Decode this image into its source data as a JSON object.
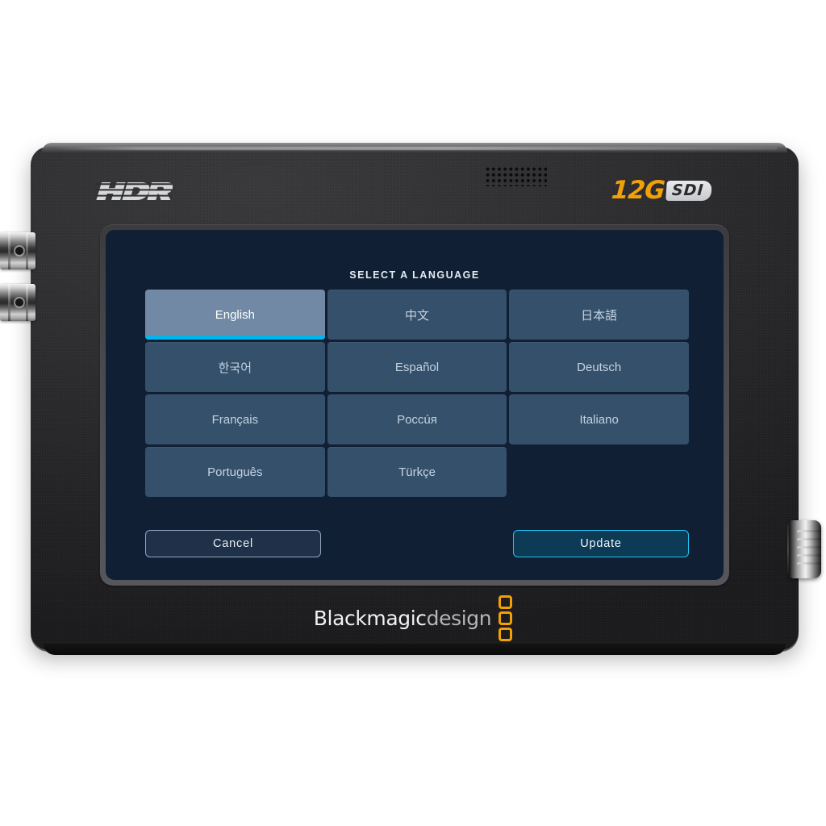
{
  "device": {
    "hdr_badge": "HDR",
    "sdi_prefix": "12G",
    "sdi_suffix": "SDI",
    "brand_primary": "Blackmagic",
    "brand_secondary": "design",
    "accent_orange": "#f2a007",
    "body_color": "#2f2f31"
  },
  "screen": {
    "title": "SELECT A LANGUAGE",
    "background_color": "#101f33",
    "selected_color": "#7189a5",
    "cell_color": "#35506b",
    "highlight_color": "#00b6ed",
    "languages": [
      {
        "label": "English",
        "selected": true
      },
      {
        "label": "中文",
        "selected": false
      },
      {
        "label": "日本語",
        "selected": false
      },
      {
        "label": "한국어",
        "selected": false
      },
      {
        "label": "Español",
        "selected": false
      },
      {
        "label": "Deutsch",
        "selected": false
      },
      {
        "label": "Français",
        "selected": false
      },
      {
        "label": "Pоссúя",
        "selected": false
      },
      {
        "label": "Italiano",
        "selected": false
      },
      {
        "label": "Português",
        "selected": false
      },
      {
        "label": "Türkçe",
        "selected": false
      }
    ],
    "buttons": {
      "cancel_label": "Cancel",
      "update_label": "Update"
    }
  }
}
